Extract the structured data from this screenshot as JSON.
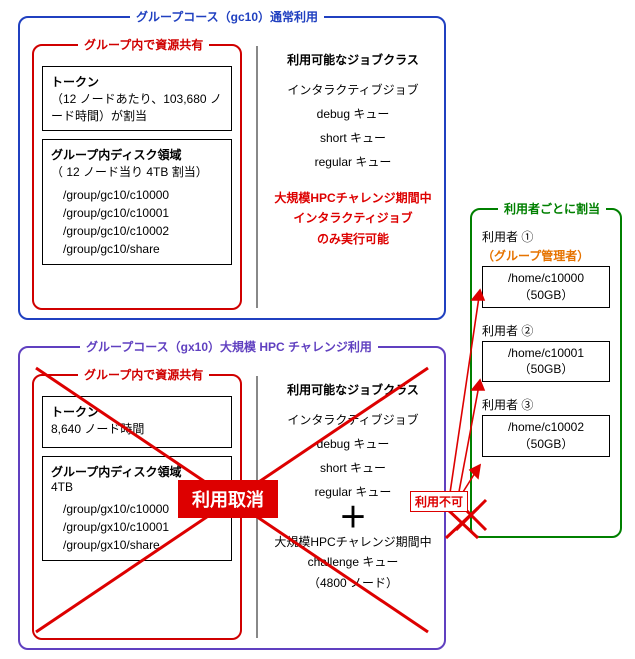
{
  "group_gc10": {
    "title": "グループコース（gc10）通常利用",
    "title_color": "#2040c0",
    "resource": {
      "title": "グループ内で資源共有",
      "title_color": "#d00000",
      "token": {
        "label": "トークン",
        "detail": "（12 ノードあたり、103,680 ノード時間）が割当"
      },
      "disk": {
        "label": "グループ内ディスク領域",
        "detail": "（ 12 ノード当り 4TB 割当）",
        "paths": [
          "/group/gc10/c10000",
          "/group/gc10/c10001",
          "/group/gc10/c10002",
          "/group/gc10/share"
        ]
      }
    },
    "jobs": {
      "heading": "利用可能なジョブクラス",
      "items": [
        "インタラクティブジョブ",
        "debug キュー",
        "short キュー",
        "regular キュー"
      ],
      "note_lines": [
        "大規模HPCチャレンジ期間中",
        "インタラクティジョブ",
        "のみ実行可能"
      ]
    }
  },
  "group_gx10": {
    "title": "グループコース（gx10）大規模 HPC チャレンジ利用",
    "title_color": "#6040c0",
    "resource": {
      "title": "グループ内で資源共有",
      "title_color": "#d00000",
      "token": {
        "label": "トークン",
        "detail": "8,640 ノード時間"
      },
      "disk": {
        "label": "グループ内ディスク領域",
        "detail": "4TB",
        "paths": [
          "/group/gx10/c10000",
          "/group/gx10/c10001",
          "/group/gx10/share"
        ]
      }
    },
    "jobs": {
      "heading": "利用可能なジョブクラス",
      "items": [
        "インタラクティブジョブ",
        "debug キュー",
        "short キュー",
        "regular キュー"
      ],
      "challenge_lines": [
        "大規模HPCチャレンジ期間中",
        "challenge キュー",
        "（4800 ノード）"
      ]
    },
    "cancel_label": "利用取消",
    "unavailable_label": "利用不可"
  },
  "users": {
    "title": "利用者ごとに割当",
    "title_color": "#008000",
    "list": [
      {
        "label": "利用者 ①",
        "admin_label": "（グループ管理者）",
        "home": "/home/c10000",
        "quota": "（50GB）"
      },
      {
        "label": "利用者 ②",
        "admin_label": "",
        "home": "/home/c10001",
        "quota": "（50GB）"
      },
      {
        "label": "利用者 ③",
        "admin_label": "",
        "home": "/home/c10002",
        "quota": "（50GB）"
      }
    ]
  },
  "plus": "＋"
}
